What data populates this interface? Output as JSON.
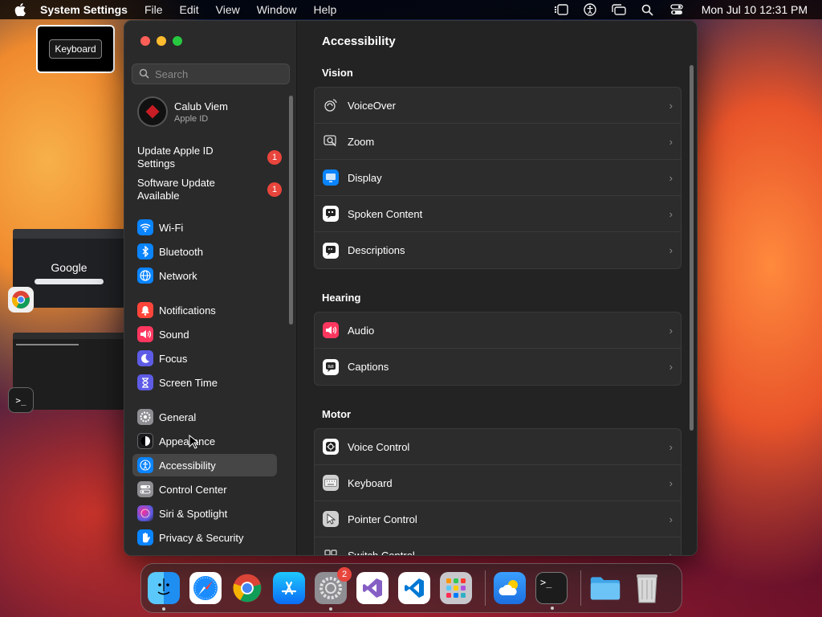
{
  "menubar": {
    "app_name": "System Settings",
    "items": [
      "File",
      "Edit",
      "View",
      "Window",
      "Help"
    ],
    "clock": "Mon Jul 10  12:31 PM"
  },
  "thumbnails": {
    "keyboard_label": "Keyboard",
    "chrome_logo": "Google",
    "terminal_prompt": ">_"
  },
  "window": {
    "search": {
      "placeholder": "Search"
    },
    "profile": {
      "name": "Calub Viem",
      "subtitle": "Apple ID"
    },
    "notices": [
      {
        "label": "Update Apple ID Settings",
        "badge": "1"
      },
      {
        "label": "Software Update Available",
        "badge": "1"
      }
    ],
    "sidebar": {
      "wifi": "Wi-Fi",
      "bluetooth": "Bluetooth",
      "network": "Network",
      "notifications": "Notifications",
      "sound": "Sound",
      "focus": "Focus",
      "screen_time": "Screen Time",
      "general": "General",
      "appearance": "Appearance",
      "accessibility": "Accessibility",
      "control_center": "Control Center",
      "siri": "Siri & Spotlight",
      "privacy": "Privacy & Security"
    },
    "content": {
      "title": "Accessibility",
      "vision": {
        "title": "Vision",
        "rows": [
          "VoiceOver",
          "Zoom",
          "Display",
          "Spoken Content",
          "Descriptions"
        ]
      },
      "hearing": {
        "title": "Hearing",
        "rows": [
          "Audio",
          "Captions"
        ]
      },
      "motor": {
        "title": "Motor",
        "rows": [
          "Voice Control",
          "Keyboard",
          "Pointer Control",
          "Switch Control"
        ]
      },
      "chevron": "›"
    }
  },
  "dock": {
    "settings_badge": "2",
    "terminal_prompt": ">_"
  },
  "colors": {
    "accent_blue": "#0a84ff",
    "badge_red": "#e8453c",
    "window_bg": "#232323",
    "sidebar_bg": "#2a2a2a"
  }
}
